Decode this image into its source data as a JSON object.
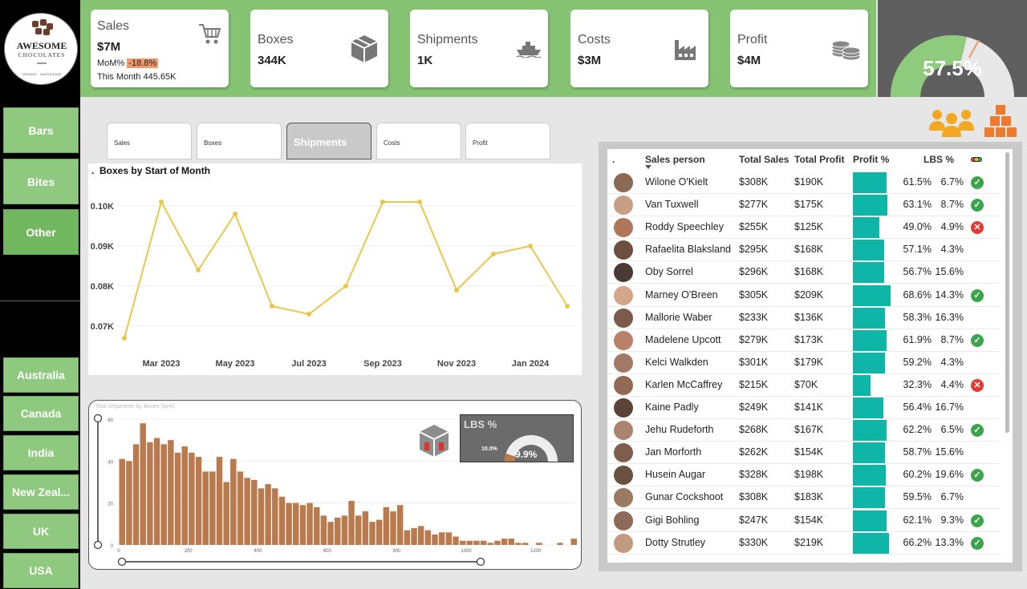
{
  "logo": {
    "line1": "AWESOME",
    "line2": "CHOCOLATES",
    "tag": "ORGANIC · WHOLESOME"
  },
  "sidebar": {
    "products": [
      {
        "label": "Bars"
      },
      {
        "label": "Bites"
      },
      {
        "label": "Other"
      }
    ],
    "countries": [
      {
        "label": "Australia"
      },
      {
        "label": "Canada"
      },
      {
        "label": "India"
      },
      {
        "label": "New Zeal..."
      },
      {
        "label": "UK"
      },
      {
        "label": "USA"
      }
    ]
  },
  "kpis": {
    "sales": {
      "label": "Sales",
      "value": "$7M",
      "mom_label": "MoM%",
      "mom_value": "-18.8%",
      "month_label": "This Month 445.65K"
    },
    "boxes": {
      "label": "Boxes",
      "value": "344K"
    },
    "shipments": {
      "label": "Shipments",
      "value": "1K"
    },
    "costs": {
      "label": "Costs",
      "value": "$3M"
    },
    "profit": {
      "label": "Profit",
      "value": "$4M"
    }
  },
  "gauge": {
    "value": "57.5%",
    "fraction": 0.575
  },
  "tabs": [
    {
      "label": "Sales"
    },
    {
      "label": "Boxes"
    },
    {
      "label": "Shipments"
    },
    {
      "label": "Costs"
    },
    {
      "label": "Profit"
    }
  ],
  "colors": {
    "green": "#86c474",
    "teal": "#0fb6a8",
    "line": "#e8c84a",
    "hist": "#b97a4e"
  },
  "chart_data": [
    {
      "type": "line",
      "title": "Boxes by Start of Month",
      "x": [
        "Feb 2023",
        "Mar 2023",
        "Apr 2023",
        "May 2023",
        "Jun 2023",
        "Jul 2023",
        "Aug 2023",
        "Sep 2023",
        "Oct 2023",
        "Nov 2023",
        "Dec 2023",
        "Jan 2024",
        "Feb 2024"
      ],
      "values": [
        0.067,
        0.101,
        0.084,
        0.098,
        0.075,
        0.073,
        0.08,
        0.101,
        0.101,
        0.079,
        0.088,
        0.09,
        0.075
      ],
      "yticks": [
        "0.10K",
        "0.09K",
        "0.08K",
        "0.07K"
      ],
      "xticks": [
        "Mar 2023",
        "May 2023",
        "Jul 2023",
        "Sep 2023",
        "Nov 2023",
        "Jan 2024"
      ],
      "ylim": [
        0.065,
        0.103
      ]
    },
    {
      "type": "bar",
      "title": "Total Shipments by Boxes (bins)",
      "bin_width": 20,
      "x_start": 0,
      "values": [
        41,
        40,
        48,
        58,
        49,
        51,
        48,
        50,
        44,
        47,
        44,
        42,
        35,
        35,
        42,
        30,
        41,
        35,
        32,
        31,
        27,
        29,
        27,
        23,
        20,
        20,
        19,
        20,
        18,
        14,
        11,
        13,
        14,
        21,
        14,
        16,
        11,
        12,
        18,
        16,
        19,
        7,
        8,
        9,
        7,
        5,
        6,
        6,
        4,
        2,
        2,
        2,
        2,
        1,
        2,
        3,
        3,
        1,
        1,
        0,
        1,
        0,
        0,
        1,
        0,
        3
      ],
      "xticks": [
        "0",
        "200",
        "400",
        "600",
        "800",
        "1000",
        "1200"
      ],
      "yticks": [
        "60",
        "40",
        "20",
        "0"
      ],
      "ylim": [
        0,
        60
      ]
    }
  ],
  "lbs_card": {
    "title": "LBS %",
    "value": "9.9%",
    "target": "10.0%",
    "fraction": 0.099
  },
  "table": {
    "headers": {
      "dot": ".",
      "person": "Sales person",
      "sales": "Total Sales",
      "profit": "Total Profit",
      "pct": "Profit %",
      "lbs": "LBS %"
    },
    "rows": [
      {
        "name": "Wilone O'Kielt",
        "sales": "$308K",
        "profit": "$190K",
        "pct": "61.5%",
        "pct_val": 61.5,
        "lbs": "6.7%",
        "status": "ok"
      },
      {
        "name": "Van Tuxwell",
        "sales": "$277K",
        "profit": "$175K",
        "pct": "63.1%",
        "pct_val": 63.1,
        "lbs": "8.7%",
        "status": "ok"
      },
      {
        "name": "Roddy Speechley",
        "sales": "$255K",
        "profit": "$125K",
        "pct": "49.0%",
        "pct_val": 49.0,
        "lbs": "4.9%",
        "status": "bad"
      },
      {
        "name": "Rafaelita Blaksland",
        "sales": "$295K",
        "profit": "$168K",
        "pct": "57.1%",
        "pct_val": 57.1,
        "lbs": "4.3%",
        "status": ""
      },
      {
        "name": "Oby Sorrel",
        "sales": "$296K",
        "profit": "$168K",
        "pct": "56.7%",
        "pct_val": 56.7,
        "lbs": "15.6%",
        "status": ""
      },
      {
        "name": "Marney O'Breen",
        "sales": "$305K",
        "profit": "$209K",
        "pct": "68.6%",
        "pct_val": 68.6,
        "lbs": "14.3%",
        "status": "ok"
      },
      {
        "name": "Mallorie Waber",
        "sales": "$233K",
        "profit": "$136K",
        "pct": "58.3%",
        "pct_val": 58.3,
        "lbs": "16.3%",
        "status": ""
      },
      {
        "name": "Madelene Upcott",
        "sales": "$279K",
        "profit": "$173K",
        "pct": "61.9%",
        "pct_val": 61.9,
        "lbs": "8.7%",
        "status": "ok"
      },
      {
        "name": "Kelci Walkden",
        "sales": "$301K",
        "profit": "$179K",
        "pct": "59.2%",
        "pct_val": 59.2,
        "lbs": "4.3%",
        "status": ""
      },
      {
        "name": "Karlen McCaffrey",
        "sales": "$215K",
        "profit": "$70K",
        "pct": "32.3%",
        "pct_val": 32.3,
        "lbs": "4.4%",
        "status": "bad"
      },
      {
        "name": "Kaine Padly",
        "sales": "$249K",
        "profit": "$141K",
        "pct": "56.4%",
        "pct_val": 56.4,
        "lbs": "16.7%",
        "status": ""
      },
      {
        "name": "Jehu Rudeforth",
        "sales": "$268K",
        "profit": "$167K",
        "pct": "62.2%",
        "pct_val": 62.2,
        "lbs": "6.5%",
        "status": "ok"
      },
      {
        "name": "Jan Morforth",
        "sales": "$262K",
        "profit": "$154K",
        "pct": "58.7%",
        "pct_val": 58.7,
        "lbs": "15.6%",
        "status": ""
      },
      {
        "name": "Husein Augar",
        "sales": "$328K",
        "profit": "$198K",
        "pct": "60.2%",
        "pct_val": 60.2,
        "lbs": "19.6%",
        "status": "ok"
      },
      {
        "name": "Gunar Cockshoot",
        "sales": "$308K",
        "profit": "$183K",
        "pct": "59.5%",
        "pct_val": 59.5,
        "lbs": "6.7%",
        "status": ""
      },
      {
        "name": "Gigi Bohling",
        "sales": "$247K",
        "profit": "$154K",
        "pct": "62.1%",
        "pct_val": 62.1,
        "lbs": "9.3%",
        "status": "ok"
      },
      {
        "name": "Dotty Strutley",
        "sales": "$330K",
        "profit": "$219K",
        "pct": "66.2%",
        "pct_val": 66.2,
        "lbs": "13.3%",
        "status": "ok"
      }
    ]
  }
}
